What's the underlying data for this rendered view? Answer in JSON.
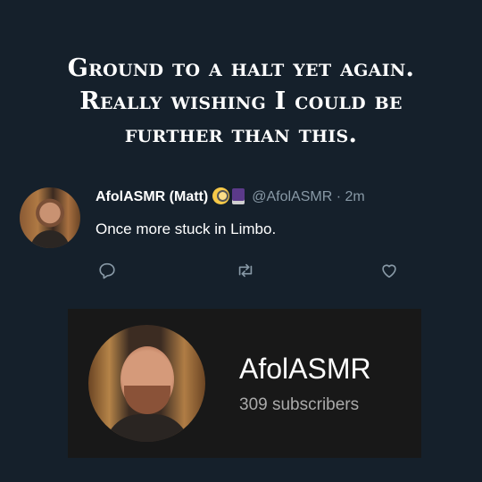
{
  "headline": {
    "line1": "Ground to a halt yet again.",
    "line2": "Really wishing I could be",
    "line3": "further than this."
  },
  "tweet": {
    "display_name": "AfolASMR (Matt)",
    "name_emojis": [
      "face-with-monocle-emoji",
      "book-emoji"
    ],
    "handle": "@AfolASMR",
    "separator": "·",
    "time": "2m",
    "text": "Once more stuck in Limbo.",
    "actions": [
      "reply-icon",
      "retweet-icon",
      "like-icon"
    ],
    "colors": {
      "background": "#15202b",
      "secondary_text": "#8899a6"
    }
  },
  "channel_card": {
    "name": "AfolASMR",
    "subscribers": "309 subscribers",
    "colors": {
      "background": "#181818",
      "secondary_text": "#aaaaaa"
    }
  }
}
